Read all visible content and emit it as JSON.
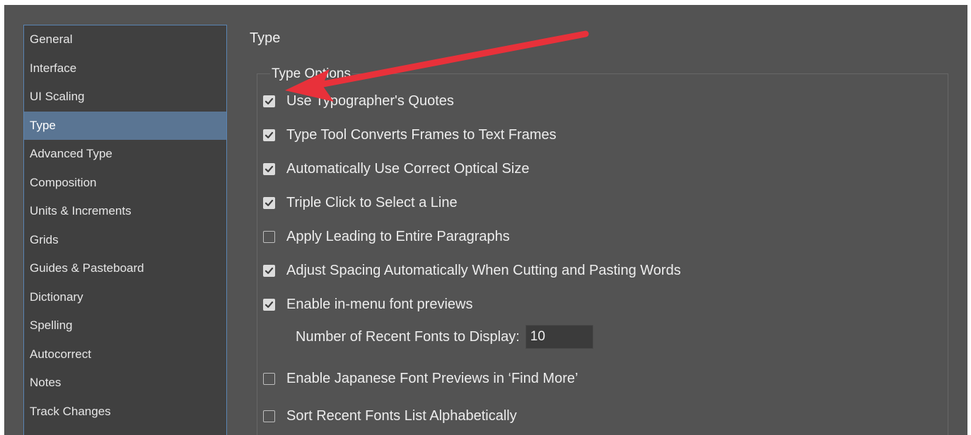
{
  "sidebar": {
    "items": [
      {
        "label": "General",
        "selected": false
      },
      {
        "label": "Interface",
        "selected": false
      },
      {
        "label": "UI Scaling",
        "selected": false
      },
      {
        "label": "Type",
        "selected": true
      },
      {
        "label": "Advanced Type",
        "selected": false
      },
      {
        "label": "Composition",
        "selected": false
      },
      {
        "label": "Units & Increments",
        "selected": false
      },
      {
        "label": "Grids",
        "selected": false
      },
      {
        "label": "Guides & Pasteboard",
        "selected": false
      },
      {
        "label": "Dictionary",
        "selected": false
      },
      {
        "label": "Spelling",
        "selected": false
      },
      {
        "label": "Autocorrect",
        "selected": false
      },
      {
        "label": "Notes",
        "selected": false
      },
      {
        "label": "Track Changes",
        "selected": false
      }
    ]
  },
  "main": {
    "title": "Type",
    "group_title": "Type Options",
    "options": [
      {
        "label": "Use Typographer's Quotes",
        "checked": true
      },
      {
        "label": "Type Tool Converts Frames to Text Frames",
        "checked": true
      },
      {
        "label": "Automatically Use Correct Optical Size",
        "checked": true
      },
      {
        "label": "Triple Click to Select a Line",
        "checked": true
      },
      {
        "label": "Apply Leading to Entire Paragraphs",
        "checked": false
      },
      {
        "label": "Adjust Spacing Automatically When Cutting and Pasting Words",
        "checked": true
      },
      {
        "label": "Enable in-menu font previews",
        "checked": true
      },
      {
        "label": "Enable Japanese Font Previews in ‘Find More’",
        "checked": false
      },
      {
        "label": "Sort Recent Fonts List Alphabetically",
        "checked": false
      }
    ],
    "recent_fonts": {
      "label": "Number of Recent Fonts to Display:",
      "value": "10"
    }
  },
  "annotation": {
    "arrow_color": "#e8313a"
  },
  "colors": {
    "panel_bg": "#535353",
    "sidebar_bg": "#404040",
    "sidebar_selected": "#5a7593",
    "sidebar_border": "#5a84b3"
  }
}
